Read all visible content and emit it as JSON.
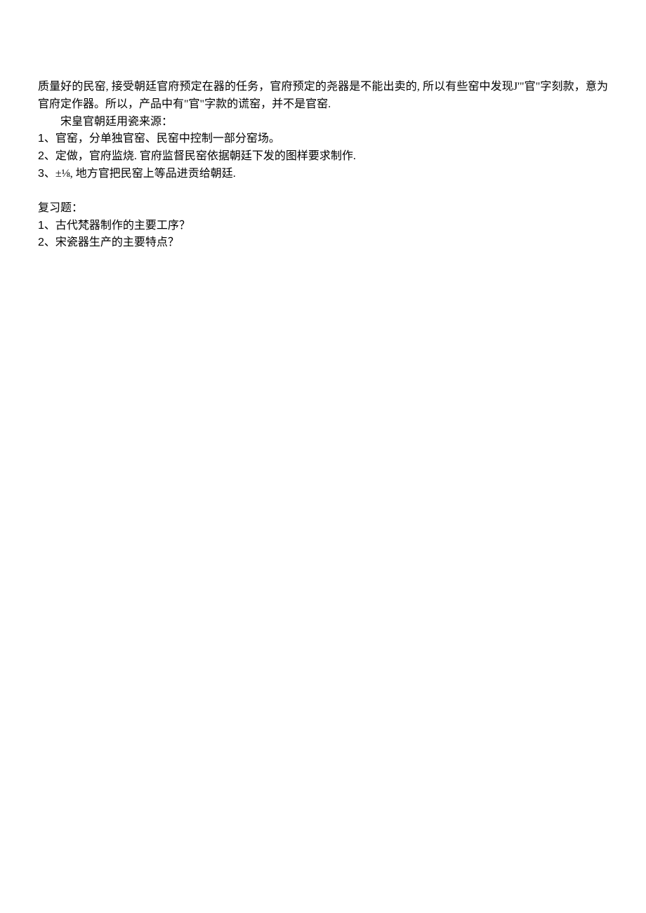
{
  "p1_line1": "质量好的民窑, 接受朝廷官府预定在器的任务，官府预定的尧器是不能出卖的, 所以有些窑中发现J'\"官\"字刻款，意为官府定作器。所以，产品中有\"官\"字款的谎窑，并不是官窑.",
  "p2_indent": "宋皇官朝廷用瓷来源：",
  "list1": {
    "item1_num": "1、",
    "item1_txt": "官窑，分单独官窑、民窑中控制一部分窑场。",
    "item2_num": "2、",
    "item2_txt": "定做，官府监烧. 官府监督民窑依据朝廷下发的图样要求制作.",
    "item3_num": "3、",
    "item3_txt": "±⅛, 地方官把民窑上等品进贡给朝廷."
  },
  "review_heading": "复习题：",
  "list2": {
    "item1_num": "1、",
    "item1_txt": "古代梵器制作的主要工序？",
    "item2_num": "2、",
    "item2_txt": "宋瓷器生产的主要特点？"
  }
}
